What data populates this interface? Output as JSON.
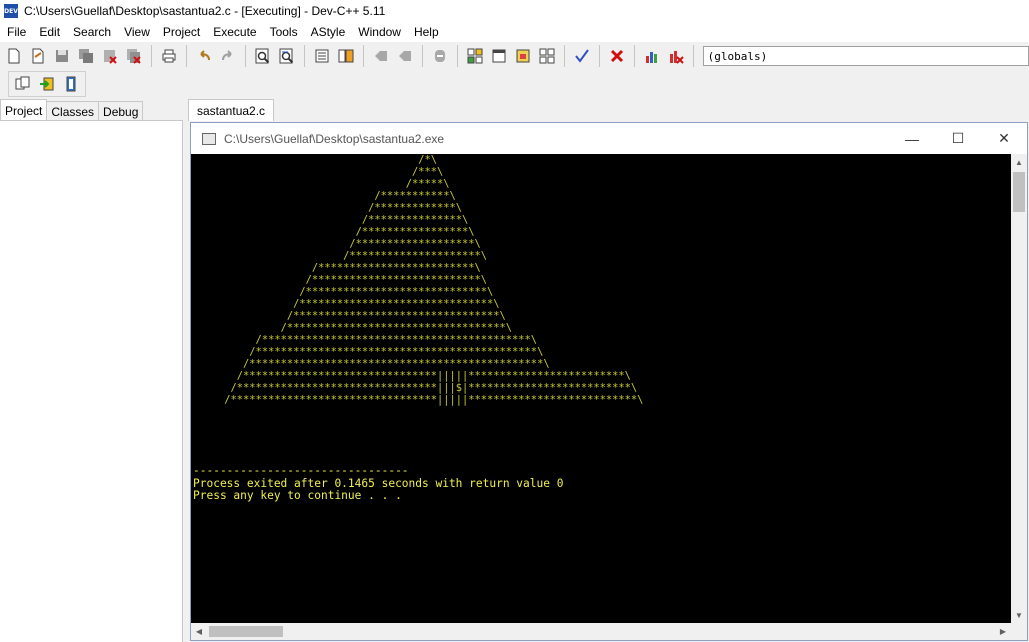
{
  "window": {
    "title": "C:\\Users\\Guellaf\\Desktop\\sastantua2.c - [Executing] - Dev-C++ 5.11",
    "app_icon_text": "DEV"
  },
  "menu": [
    "File",
    "Edit",
    "Search",
    "View",
    "Project",
    "Execute",
    "Tools",
    "AStyle",
    "Window",
    "Help"
  ],
  "toolbar": {
    "globals_value": "(globals)",
    "icons": [
      "new-file-icon",
      "open-file-icon",
      "save-icon",
      "save-all-icon",
      "close-icon",
      "close-all-icon",
      "print-icon",
      "undo-icon",
      "redo-icon",
      "find-icon",
      "replace-icon",
      "indent-icon",
      "unindent-icon",
      "toggle-bookmark-icon",
      "goto-bookmark-icon",
      "comment-icon",
      "new-project-icon",
      "view-icon",
      "class-browser-icon",
      "layout-icon",
      "check-icon",
      "stop-icon",
      "chart-icon",
      "profile-icon"
    ]
  },
  "toolbar2": {
    "icons": [
      "copy-icon",
      "insert-icon",
      "book-icon"
    ]
  },
  "left_tabs": [
    "Project",
    "Classes",
    "Debug"
  ],
  "editor_tab": "sastantua2.c",
  "console": {
    "title": "C:\\Users\\Guellaf\\Desktop\\sastantua2.exe",
    "minimize": "—",
    "maximize": "☐",
    "close": "✕",
    "output": "                                    /*\\\n                                   /***\\\n                                  /*****\\\n                             /***********\\\n                            /*************\\\n                           /***************\\\n                          /*****************\\\n                         /*******************\\\n                        /*********************\\\n                   /*************************\\\n                  /***************************\\\n                 /*****************************\\\n                /*******************************\\\n               /*********************************\\\n              /***********************************\\\n          /*******************************************\\\n         /*********************************************\\\n        /***********************************************\\\n       /*******************************|||||*************************\\\n      /********************************|||$|**************************\\\n     /*********************************|||||***************************\\",
    "separator": "--------------------------------",
    "exit_message": "Process exited after 0.1465 seconds with return value 0",
    "continue_message": "Press any key to continue . . ."
  }
}
